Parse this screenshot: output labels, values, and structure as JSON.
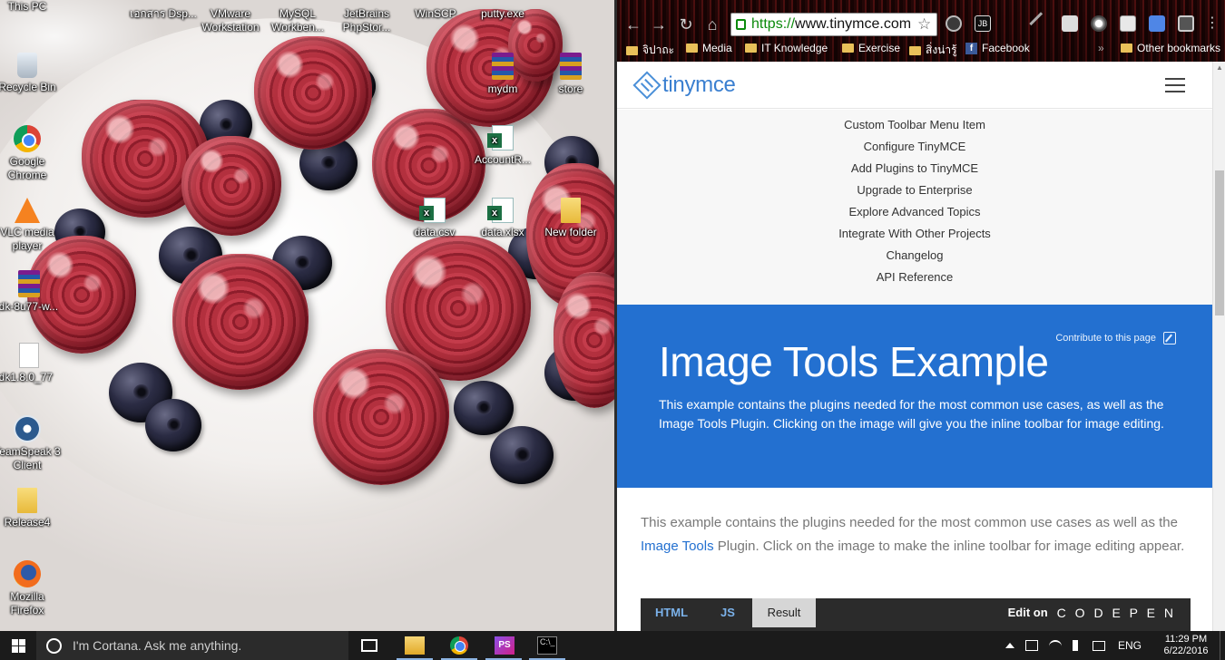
{
  "desktop": {
    "icons": [
      {
        "label": "This PC",
        "icon": "this-pc-icon"
      },
      {
        "label": "Recycle Bin",
        "icon": "recycle-bin-icon"
      },
      {
        "label": "Google Chrome",
        "icon": "chrome-icon"
      },
      {
        "label": "VLC media player",
        "icon": "vlc-icon"
      },
      {
        "label": "jdk-8u77-w...",
        "icon": "winrar-icon"
      },
      {
        "label": "jdk1.8.0_77",
        "icon": "file-icon"
      },
      {
        "label": "TeamSpeak 3 Client",
        "icon": "teamspeak-icon"
      },
      {
        "label": "Release4",
        "icon": "folder-icon"
      },
      {
        "label": "Mozilla Firefox",
        "icon": "firefox-icon"
      },
      {
        "label": "เอกสาร Dsp...",
        "icon": "document-icon"
      },
      {
        "label": "VMware Workstation",
        "icon": "vmware-icon"
      },
      {
        "label": "MySQL Workben...",
        "icon": "mysql-icon"
      },
      {
        "label": "JetBrains PhpStor...",
        "icon": "phpstorm-icon"
      },
      {
        "label": "WinSCP",
        "icon": "winscp-icon"
      },
      {
        "label": "putty.exe",
        "icon": "putty-icon"
      },
      {
        "label": "mydm",
        "icon": "winrar-icon"
      },
      {
        "label": "store",
        "icon": "winrar-icon"
      },
      {
        "label": "AccountR...",
        "icon": "excel-icon"
      },
      {
        "label": "data.csv",
        "icon": "excel-icon"
      },
      {
        "label": "data.xlsx",
        "icon": "excel-icon"
      },
      {
        "label": "New folder",
        "icon": "folder-icon"
      }
    ]
  },
  "browser": {
    "url_scheme": "https://",
    "url_host": "www.tinymce.com",
    "bookmarks": [
      "จิปาถะ",
      "Media",
      "IT Knowledge",
      "Exercise",
      "สิ่งน่ารู้",
      "Facebook"
    ],
    "other_bookmarks": "Other bookmarks",
    "overflow": "»"
  },
  "page": {
    "logo_text": "tinymce",
    "menu": [
      "Custom Toolbar Menu Item",
      "Configure TinyMCE",
      "Add Plugins to TinyMCE",
      "Upgrade to Enterprise",
      "Explore Advanced Topics",
      "Integrate With Other Projects",
      "Changelog",
      "API Reference"
    ],
    "contribute": "Contribute to this page",
    "title": "Image Tools Example",
    "lead": "This example contains the plugins needed for the most common use cases, as well as the Image Tools Plugin. Clicking on the image will give you the inline toolbar for image editing.",
    "intro_before": "This example contains the plugins needed for the most common use cases as well as the ",
    "intro_link": "Image Tools",
    "intro_after": " Plugin. Click on the image to make the inline toolbar for image editing appear.",
    "tabs": [
      "HTML",
      "JS",
      "Result"
    ],
    "active_tab": "Result",
    "edit_on": "Edit on",
    "codepen": "C O D E P E N",
    "accent_color": "#2370d0"
  },
  "taskbar": {
    "cortana_placeholder": "I'm Cortana. Ask me anything.",
    "language": "ENG",
    "time": "11:29 PM",
    "date": "6/22/2016"
  }
}
